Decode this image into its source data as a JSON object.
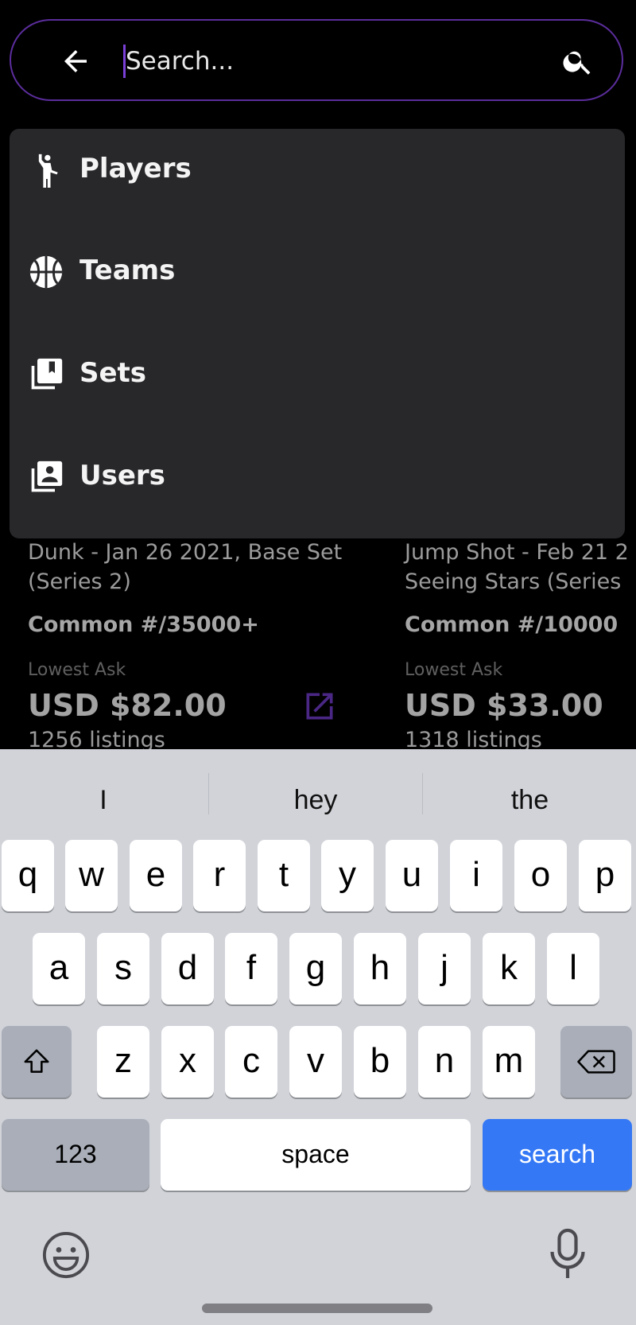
{
  "search": {
    "placeholder": "Search..."
  },
  "menu": {
    "items": [
      {
        "label": "Players",
        "icon": "player-icon"
      },
      {
        "label": "Teams",
        "icon": "basketball-icon"
      },
      {
        "label": "Sets",
        "icon": "sets-icon"
      },
      {
        "label": "Users",
        "icon": "users-icon"
      }
    ]
  },
  "cards": [
    {
      "title_line1": "Dunk - Jan 26 2021, Base Set",
      "title_line2": "(Series 2)",
      "rarity": "Common #/35000+",
      "ask_label": "Lowest Ask",
      "price": "USD $82.00",
      "listings": "1256 listings"
    },
    {
      "title_line1": "Jump Shot - Feb 21 2",
      "title_line2": "Seeing Stars (Series",
      "rarity": "Common #/10000",
      "ask_label": "Lowest Ask",
      "price": "USD $33.00",
      "listings": "1318 listings"
    }
  ],
  "keyboard": {
    "suggestions": [
      "I",
      "hey",
      "the"
    ],
    "row1": [
      "q",
      "w",
      "e",
      "r",
      "t",
      "y",
      "u",
      "i",
      "o",
      "p"
    ],
    "row2": [
      "a",
      "s",
      "d",
      "f",
      "g",
      "h",
      "j",
      "k",
      "l"
    ],
    "row3": [
      "z",
      "x",
      "c",
      "v",
      "b",
      "n",
      "m"
    ],
    "numbers_label": "123",
    "space_label": "space",
    "search_label": "search"
  },
  "colors": {
    "accent_purple": "#5b2d9c",
    "menu_bg": "#28272a",
    "search_key_blue": "#3478f6"
  }
}
